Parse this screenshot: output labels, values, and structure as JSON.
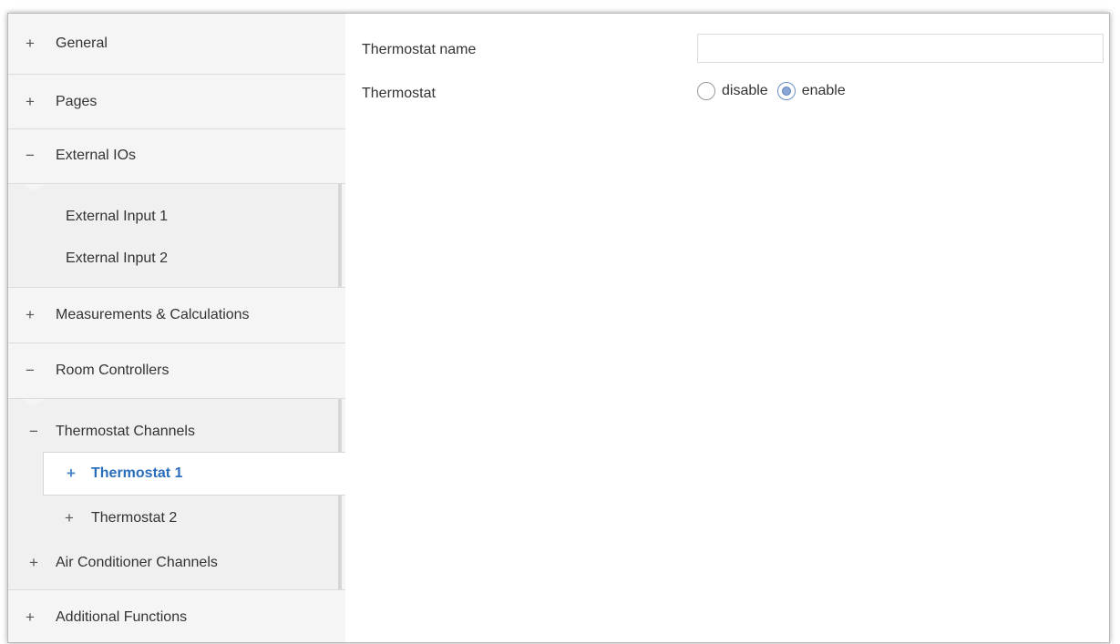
{
  "sidebar": {
    "general": {
      "symbol": "+",
      "label": "General"
    },
    "pages": {
      "symbol": "+",
      "label": "Pages"
    },
    "external_ios": {
      "symbol": "−",
      "label": "External IOs"
    },
    "external_input_1": {
      "label": "External Input 1"
    },
    "external_input_2": {
      "label": "External Input 2"
    },
    "measurements": {
      "symbol": "+",
      "label": "Measurements & Calculations"
    },
    "room_controllers": {
      "symbol": "−",
      "label": "Room Controllers"
    },
    "thermostat_channels": {
      "symbol": "−",
      "label": "Thermostat Channels"
    },
    "thermostat_1": {
      "symbol": "+",
      "label": "Thermostat 1"
    },
    "thermostat_2": {
      "symbol": "+",
      "label": "Thermostat 2"
    },
    "air_conditioner_channels": {
      "symbol": "+",
      "label": "Air Conditioner Channels"
    },
    "additional_functions": {
      "symbol": "+",
      "label": "Additional Functions"
    }
  },
  "main": {
    "thermostat_name": {
      "label": "Thermostat name",
      "value": ""
    },
    "thermostat": {
      "label": "Thermostat",
      "options": [
        {
          "label": "disable",
          "checked": false
        },
        {
          "label": "enable",
          "checked": true
        }
      ]
    }
  },
  "colors": {
    "accent": "#2a6ebb",
    "sidebar_bg": "#f5f5f5",
    "subpanel_bg": "#f0f0f0"
  }
}
